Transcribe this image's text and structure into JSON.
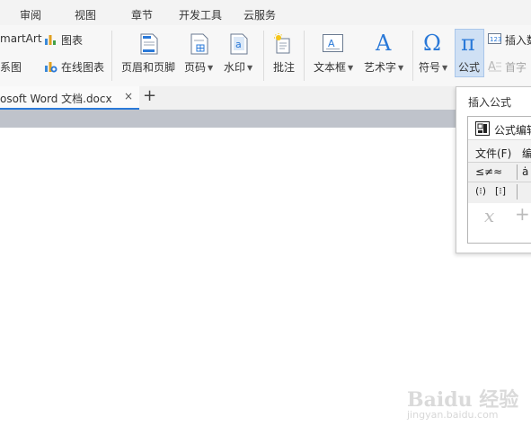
{
  "menubar": {
    "items": [
      "审阅",
      "视图",
      "章节",
      "开发工具",
      "云服务"
    ]
  },
  "ribbon": {
    "smartart": "martArt",
    "chart": "图表",
    "relation_chart": "系图",
    "online_chart": "在线图表",
    "header_footer": "页眉和页脚",
    "page_number": "页码",
    "watermark": "水印",
    "comment": "批注",
    "textbox": "文本框",
    "wordart": "艺术字",
    "symbol": "符号",
    "formula": "公式",
    "insert_number": "插入数",
    "dropcap": "首字"
  },
  "tabbar": {
    "doc_tab_label": "osoft Word 文档.docx",
    "close_glyph": "×",
    "add_glyph": "+"
  },
  "popup": {
    "title": "插入公式",
    "editor_title": "公式编辑",
    "menu": [
      "文件(F)",
      "编"
    ],
    "symbols_row1": [
      "≤≠≈",
      "ȧ"
    ],
    "symbols_row2": [
      "(⁝)",
      "[⁝]"
    ],
    "preview": [
      "x",
      "+"
    ]
  },
  "watermark": {
    "logo": "Baidu 经验",
    "url": "jingyan.baidu.com"
  },
  "colors": {
    "accent": "#2a79d8",
    "menubar_bg": "#f3f3f3",
    "ribbon_bg": "#f7f7f7",
    "doc_header_bg": "#bfc3cb"
  }
}
